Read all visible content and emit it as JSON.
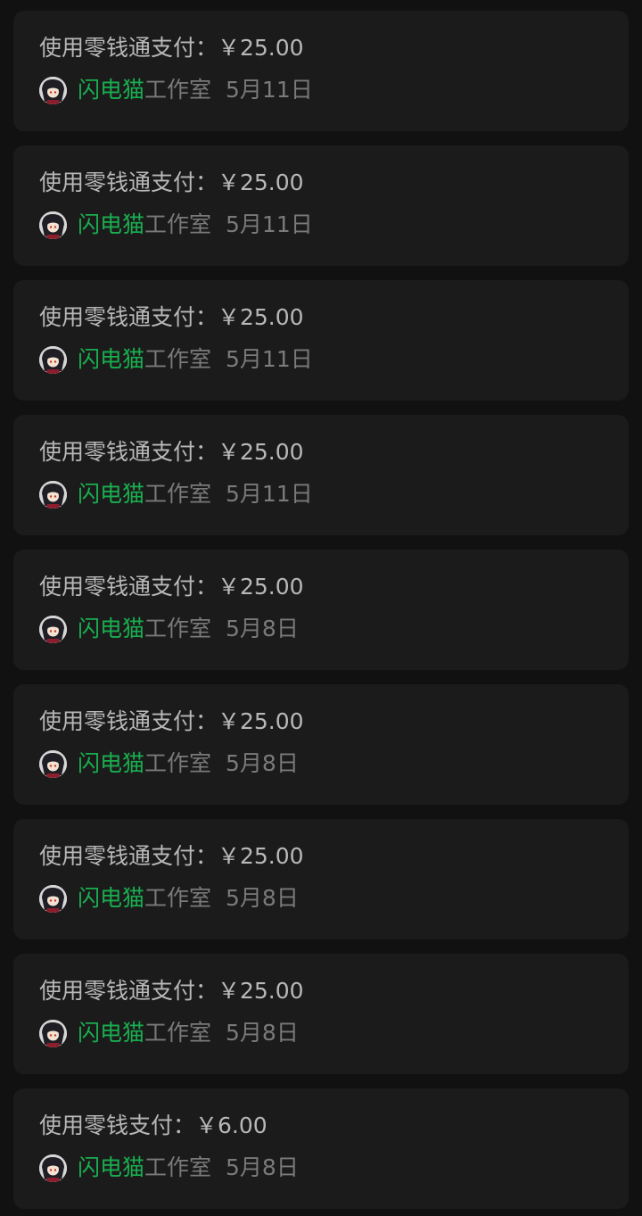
{
  "colors": {
    "background": "#111111",
    "card": "#1b1b1b",
    "primary_text": "#b8b8b8",
    "secondary_text": "#7a7a7a",
    "shop_link": "#1aad4f"
  },
  "records": [
    {
      "payment": "使用零钱通支付：￥25.00",
      "shop_name": "闪电猫",
      "shop_suffix": "工作室",
      "date": "5月11日",
      "avatar_icon": "shop-avatar-icon"
    },
    {
      "payment": "使用零钱通支付：￥25.00",
      "shop_name": "闪电猫",
      "shop_suffix": "工作室",
      "date": "5月11日",
      "avatar_icon": "shop-avatar-icon"
    },
    {
      "payment": "使用零钱通支付：￥25.00",
      "shop_name": "闪电猫",
      "shop_suffix": "工作室",
      "date": "5月11日",
      "avatar_icon": "shop-avatar-icon"
    },
    {
      "payment": "使用零钱通支付：￥25.00",
      "shop_name": "闪电猫",
      "shop_suffix": "工作室",
      "date": "5月11日",
      "avatar_icon": "shop-avatar-icon"
    },
    {
      "payment": "使用零钱通支付：￥25.00",
      "shop_name": "闪电猫",
      "shop_suffix": "工作室",
      "date": "5月8日",
      "avatar_icon": "shop-avatar-icon"
    },
    {
      "payment": "使用零钱通支付：￥25.00",
      "shop_name": "闪电猫",
      "shop_suffix": "工作室",
      "date": "5月8日",
      "avatar_icon": "shop-avatar-icon"
    },
    {
      "payment": "使用零钱通支付：￥25.00",
      "shop_name": "闪电猫",
      "shop_suffix": "工作室",
      "date": "5月8日",
      "avatar_icon": "shop-avatar-icon"
    },
    {
      "payment": "使用零钱通支付：￥25.00",
      "shop_name": "闪电猫",
      "shop_suffix": "工作室",
      "date": "5月8日",
      "avatar_icon": "shop-avatar-icon"
    },
    {
      "payment": "使用零钱支付：￥6.00",
      "shop_name": "闪电猫",
      "shop_suffix": "工作室",
      "date": "5月8日",
      "avatar_icon": "shop-avatar-icon"
    }
  ]
}
